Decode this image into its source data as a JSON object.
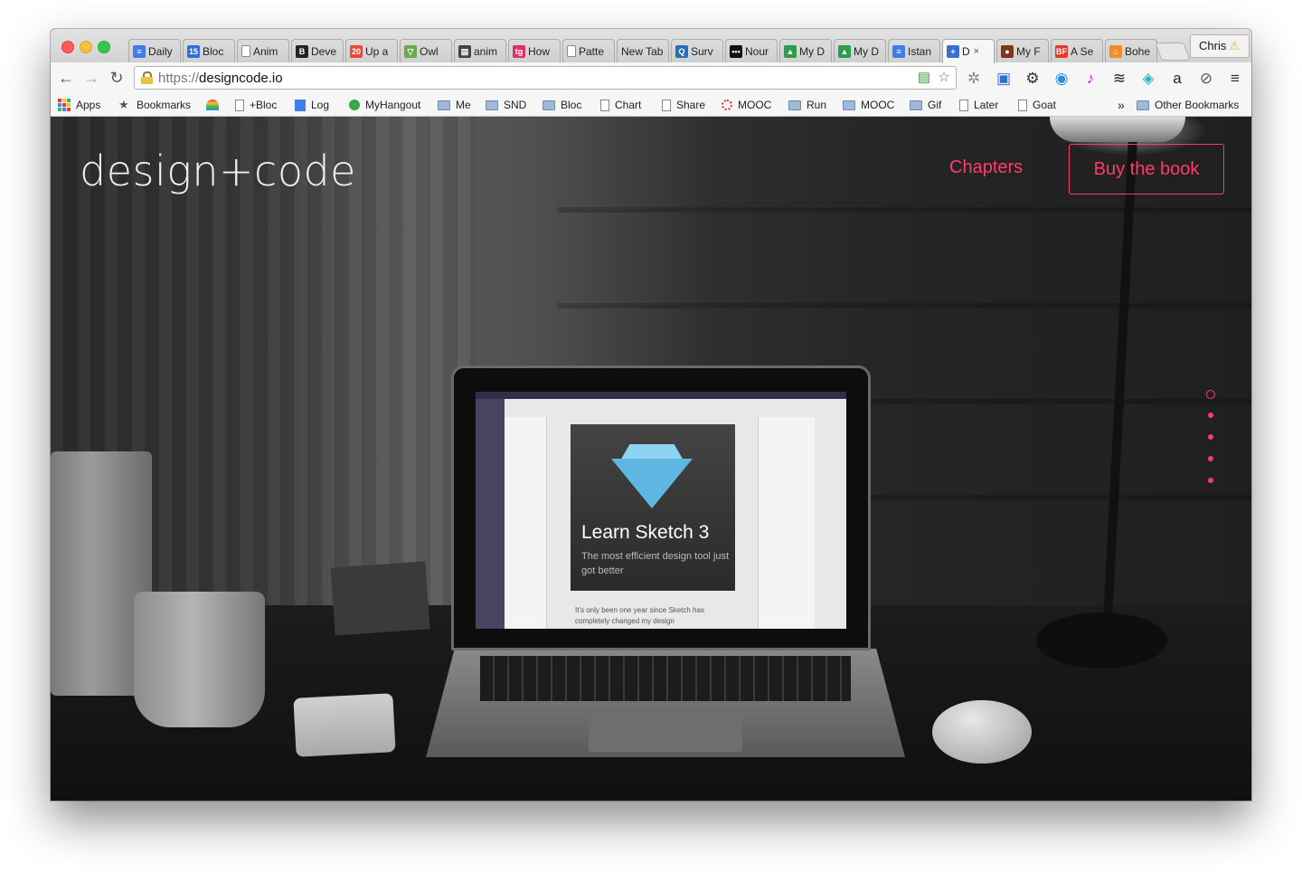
{
  "browser": {
    "tabs": [
      {
        "title": "Daily",
        "fav_color": "#3f7ee8",
        "fav_text": "≡"
      },
      {
        "title": "Bloc",
        "fav_color": "#2f6fd6",
        "fav_text": "15"
      },
      {
        "title": "Anim",
        "fav_color": "#ffffff",
        "fav_text": ""
      },
      {
        "title": "Deve",
        "fav_color": "#222222",
        "fav_text": "B"
      },
      {
        "title": "Up a",
        "fav_color": "#e64a3b",
        "fav_text": "20"
      },
      {
        "title": "Owl",
        "fav_color": "#6aa84f",
        "fav_text": "▽"
      },
      {
        "title": "anim",
        "fav_color": "#444444",
        "fav_text": "▤"
      },
      {
        "title": "How",
        "fav_color": "#e0306a",
        "fav_text": "tg"
      },
      {
        "title": "Patte",
        "fav_color": "#ffffff",
        "fav_text": ""
      },
      {
        "title": "New Tab",
        "fav_color": "",
        "fav_text": ""
      },
      {
        "title": "Surv",
        "fav_color": "#2a6fb5",
        "fav_text": "Q"
      },
      {
        "title": "Nour",
        "fav_color": "#111111",
        "fav_text": "•••"
      },
      {
        "title": "My D",
        "fav_color": "#2c9e4b",
        "fav_text": "▲"
      },
      {
        "title": "My D",
        "fav_color": "#2c9e4b",
        "fav_text": "▲"
      },
      {
        "title": "Istan",
        "fav_color": "#3f7ee8",
        "fav_text": "≡"
      },
      {
        "title": "D",
        "fav_color": "#3a6fd0",
        "fav_text": "+",
        "active": true
      },
      {
        "title": "My F",
        "fav_color": "#7a3a1a",
        "fav_text": "●"
      },
      {
        "title": "A Se",
        "fav_color": "#e23a2a",
        "fav_text": "BF"
      },
      {
        "title": "Bohe",
        "fav_color": "#f28c28",
        "fav_text": "⌂"
      }
    ],
    "tab_close": "×",
    "profile_name": "Chris",
    "profile_warning": "⚠",
    "url_scheme": "https://",
    "url_host": "designcode.io",
    "bookmarks": [
      {
        "label": "Apps",
        "icon": "apps-grid-icon"
      },
      {
        "label": "Bookmarks",
        "icon": "star-icon"
      },
      {
        "label": "",
        "icon": "rainbow-icon"
      },
      {
        "label": "+Bloc",
        "icon": "page-icon"
      },
      {
        "label": "Log",
        "icon": "doc-icon"
      },
      {
        "label": "MyHangout",
        "icon": "hangout-icon"
      },
      {
        "label": "Me",
        "icon": "folder-icon"
      },
      {
        "label": "SND",
        "icon": "folder-icon"
      },
      {
        "label": "Bloc",
        "icon": "folder-icon"
      },
      {
        "label": "Chart",
        "icon": "page-icon"
      },
      {
        "label": "Share",
        "icon": "page-icon"
      },
      {
        "label": "MOOC",
        "icon": "ring-icon"
      },
      {
        "label": "Run",
        "icon": "folder-icon"
      },
      {
        "label": "MOOC",
        "icon": "folder-icon"
      },
      {
        "label": "Gif",
        "icon": "folder-icon"
      },
      {
        "label": "Later",
        "icon": "page-icon"
      },
      {
        "label": "Goat",
        "icon": "page-icon"
      }
    ],
    "bookmarks_overflow": "»",
    "other_bookmarks": "Other Bookmarks"
  },
  "site": {
    "logo": "design+code",
    "nav_chapters": "Chapters",
    "buy_button": "Buy the book",
    "accent_color": "#ff3a6e",
    "hero_screen": {
      "title": "Learn Sketch 3",
      "subtitle": "The most efficient design tool just got better",
      "body": "It's only been one year since Sketch has completely changed my design"
    },
    "section_dots": 5,
    "active_dot": 1
  }
}
